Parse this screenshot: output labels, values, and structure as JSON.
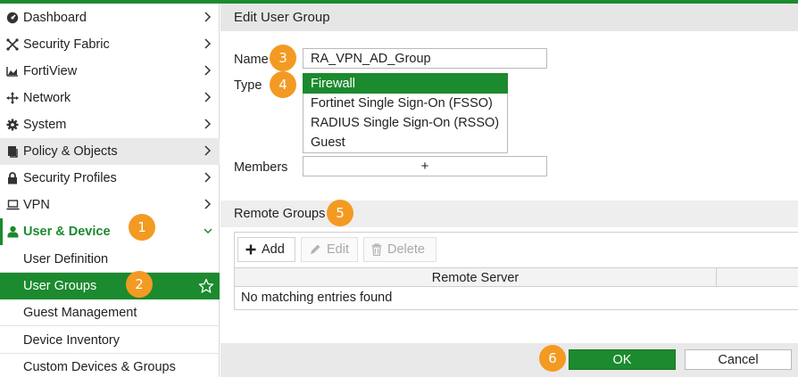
{
  "sidebar": {
    "items": [
      {
        "label": "Dashboard",
        "icon": "dashboard-icon"
      },
      {
        "label": "Security Fabric",
        "icon": "security-fabric-icon"
      },
      {
        "label": "FortiView",
        "icon": "fortiview-icon"
      },
      {
        "label": "Network",
        "icon": "network-icon"
      },
      {
        "label": "System",
        "icon": "gear-icon"
      },
      {
        "label": "Policy & Objects",
        "icon": "policy-icon"
      },
      {
        "label": "Security Profiles",
        "icon": "lock-icon"
      },
      {
        "label": "VPN",
        "icon": "laptop-icon"
      },
      {
        "label": "User & Device",
        "icon": "user-icon"
      }
    ],
    "subitems": [
      {
        "label": "User Definition"
      },
      {
        "label": "User Groups"
      },
      {
        "label": "Guest Management"
      },
      {
        "label": "Device Inventory"
      },
      {
        "label": "Custom Devices & Groups"
      }
    ]
  },
  "badges": [
    "1",
    "2",
    "3",
    "4",
    "5",
    "6"
  ],
  "main": {
    "title": "Edit User Group",
    "name_label": "Name",
    "name_value": "RA_VPN_AD_Group",
    "type_label": "Type",
    "type_options": [
      "Firewall",
      "Fortinet Single Sign-On (FSSO)",
      "RADIUS Single Sign-On (RSSO)",
      "Guest"
    ],
    "type_selected": "Firewall",
    "members_label": "Members",
    "members_add_symbol": "+",
    "remote_groups_title": "Remote Groups",
    "toolbar": {
      "add": "Add",
      "edit": "Edit",
      "delete": "Delete"
    },
    "table": {
      "columns": [
        "Remote Server",
        ""
      ],
      "empty_text": "No matching entries found"
    },
    "footer": {
      "ok": "OK",
      "cancel": "Cancel"
    }
  },
  "colors": {
    "accent": "#1c8a2e",
    "badge": "#f39a23"
  }
}
